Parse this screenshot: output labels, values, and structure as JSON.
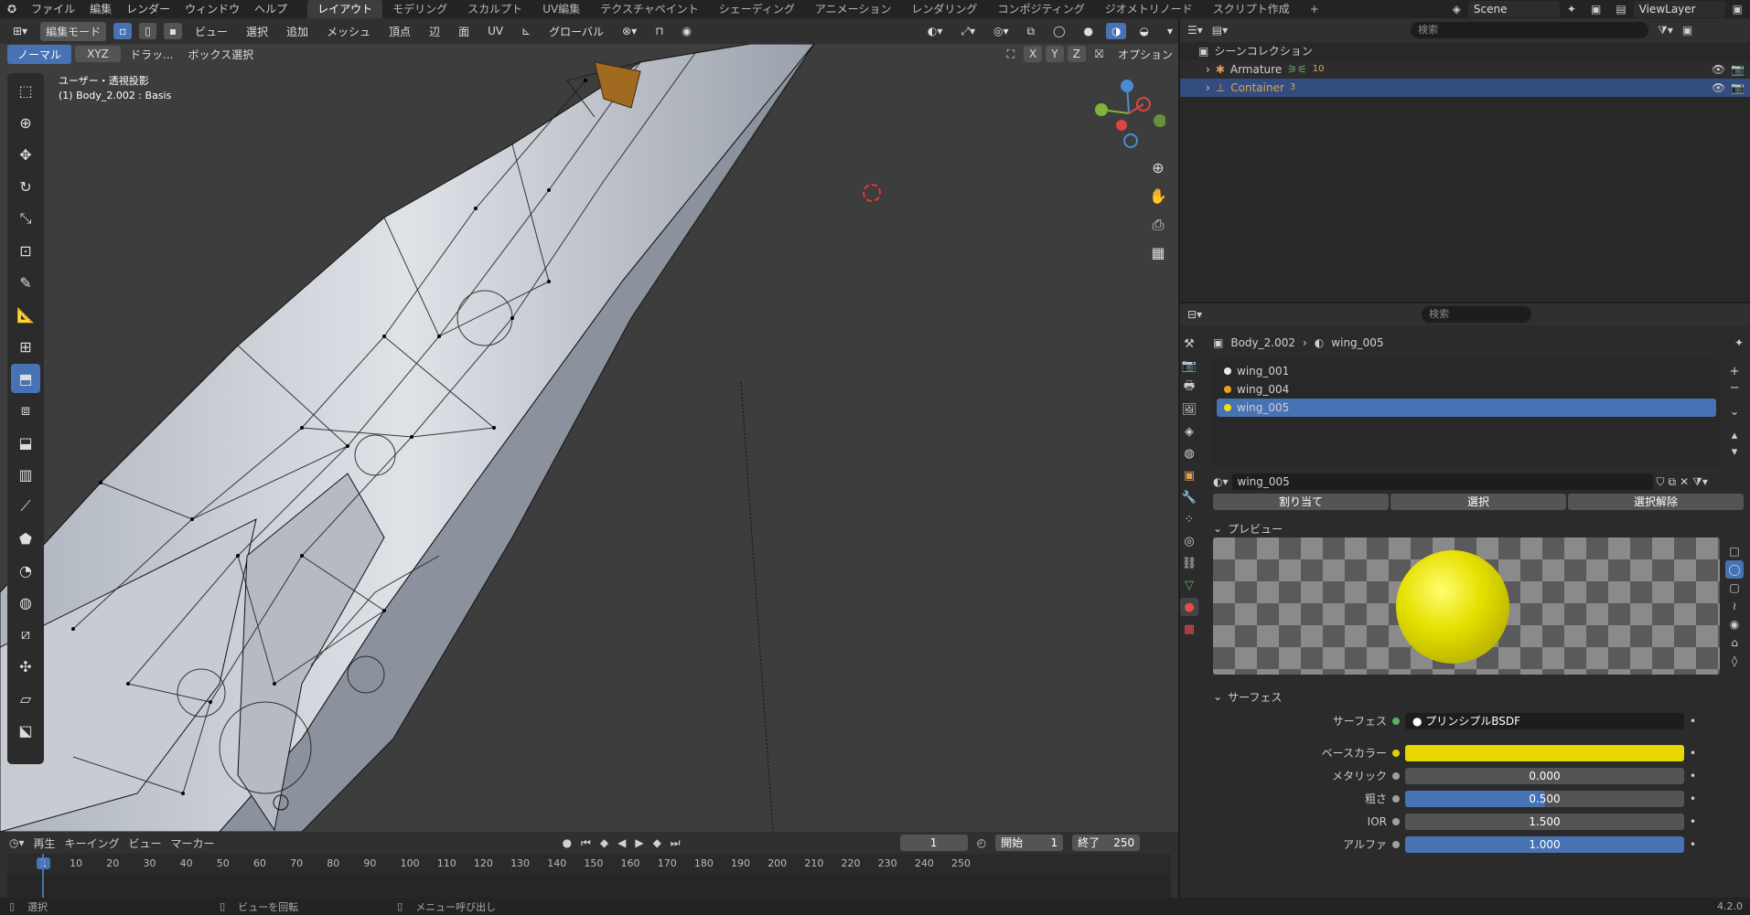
{
  "menu": {
    "items": [
      "ファイル",
      "編集",
      "レンダー",
      "ウィンドウ",
      "ヘルプ"
    ],
    "workspaces": [
      "レイアウト",
      "モデリング",
      "スカルプト",
      "UV編集",
      "テクスチャペイント",
      "シェーディング",
      "アニメーション",
      "レンダリング",
      "コンポジティング",
      "ジオメトリノード",
      "スクリプト作成"
    ],
    "add_tab": "+",
    "scene": "Scene",
    "view_layer": "ViewLayer"
  },
  "viewport_header": {
    "mode": "編集モード",
    "menus": [
      "ビュー",
      "選択",
      "追加",
      "メッシュ",
      "頂点",
      "辺",
      "面",
      "UV"
    ],
    "transform_orientation": "グローバル",
    "normal_label": "ノーマル",
    "xyz_label": "XYZ",
    "drag_label": "ドラッ...",
    "box_select_label": "ボックス選択",
    "axis_x": "X",
    "axis_y": "Y",
    "axis_z": "Z",
    "options_label": "オプション"
  },
  "viewport": {
    "view_name": "ユーザー・透視投影",
    "object_info": "(1) Body_2.002 : Basis"
  },
  "timeline": {
    "play_menu": "再生",
    "keying_menu": "キーイング",
    "view_menu": "ビュー",
    "marker_menu": "マーカー",
    "current_frame": "1",
    "start_label": "開始",
    "start_value": "1",
    "end_label": "終了",
    "end_value": "250",
    "ticks": [
      "1",
      "10",
      "20",
      "30",
      "40",
      "50",
      "60",
      "70",
      "80",
      "90",
      "100",
      "110",
      "120",
      "130",
      "140",
      "150",
      "160",
      "170",
      "180",
      "190",
      "200",
      "210",
      "220",
      "230",
      "240",
      "250"
    ]
  },
  "outliner": {
    "search_placeholder": "検索",
    "collection": "シーンコレクション",
    "items": [
      {
        "name": "Armature",
        "selected": false
      },
      {
        "name": "Container",
        "selected": true
      }
    ],
    "armature_count": "10",
    "container_count": "3"
  },
  "properties": {
    "search_placeholder": "検索",
    "breadcrumb_object": "Body_2.002",
    "breadcrumb_material": "wing_005",
    "slots": [
      {
        "name": "wing_001",
        "color": "#e8e8e8",
        "selected": false
      },
      {
        "name": "wing_004",
        "color": "#e8a020",
        "selected": false
      },
      {
        "name": "wing_005",
        "color": "#f0e010",
        "selected": true
      }
    ],
    "material_name": "wing_005",
    "assign_label": "割り当て",
    "select_label": "選択",
    "deselect_label": "選択解除",
    "preview_header": "プレビュー",
    "surface_header": "サーフェス",
    "surface_label": "サーフェス",
    "surface_value": "プリンシプルBSDF",
    "base_color_label": "ベースカラー",
    "base_color": "#e8d600",
    "metallic_label": "メタリック",
    "metallic_value": "0.000",
    "roughness_label": "粗さ",
    "roughness_value": "0.500",
    "roughness": 0.5,
    "ior_label": "IOR",
    "ior_value": "1.500",
    "alpha_label": "アルファ",
    "alpha_value": "1.000",
    "alpha": 1.0
  },
  "status": {
    "select": "選択",
    "rotate_view": "ビューを回転",
    "context_menu": "メニュー呼び出し",
    "version": "4.2.0"
  },
  "colors": {
    "accent": "#4772b3",
    "selected_text": "#e0a050"
  }
}
